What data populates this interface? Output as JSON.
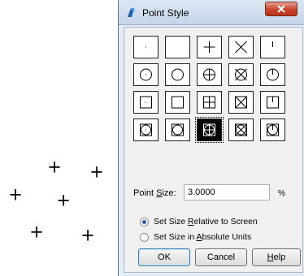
{
  "drawing": {
    "marker_glyph": "+"
  },
  "dialog": {
    "title": "Point Style",
    "size_label_pre": "Point ",
    "size_label_key": "S",
    "size_label_post": "ize:",
    "size_value": "3.0000",
    "size_unit": "%",
    "radio_relative": {
      "pre": "Set Size ",
      "key": "R",
      "post": "elative to Screen",
      "selected": true
    },
    "radio_absolute": {
      "pre": "Set Size in ",
      "key": "A",
      "post": "bsolute Units",
      "selected": false
    },
    "ok_label": "OK",
    "cancel_label": "Cancel",
    "help_key": "H",
    "help_post": "elp",
    "styles": [
      {
        "name": "dot",
        "selected": false
      },
      {
        "name": "none",
        "selected": false
      },
      {
        "name": "plus",
        "selected": false
      },
      {
        "name": "x",
        "selected": false
      },
      {
        "name": "tick",
        "selected": false
      },
      {
        "name": "circle-dot",
        "selected": false
      },
      {
        "name": "circle",
        "selected": false
      },
      {
        "name": "circle-plus",
        "selected": false
      },
      {
        "name": "circle-x",
        "selected": false
      },
      {
        "name": "circle-tick",
        "selected": false
      },
      {
        "name": "square-dot",
        "selected": false
      },
      {
        "name": "square",
        "selected": false
      },
      {
        "name": "square-plus",
        "selected": false
      },
      {
        "name": "square-x",
        "selected": false
      },
      {
        "name": "square-tick",
        "selected": false
      },
      {
        "name": "square-circle-dot",
        "selected": false
      },
      {
        "name": "square-circle",
        "selected": false
      },
      {
        "name": "square-circle-plus",
        "selected": true
      },
      {
        "name": "square-circle-x",
        "selected": false
      },
      {
        "name": "square-circle-tick",
        "selected": false
      }
    ]
  },
  "colors": {
    "accent": "#2a5caa",
    "close": "#c8432b"
  }
}
